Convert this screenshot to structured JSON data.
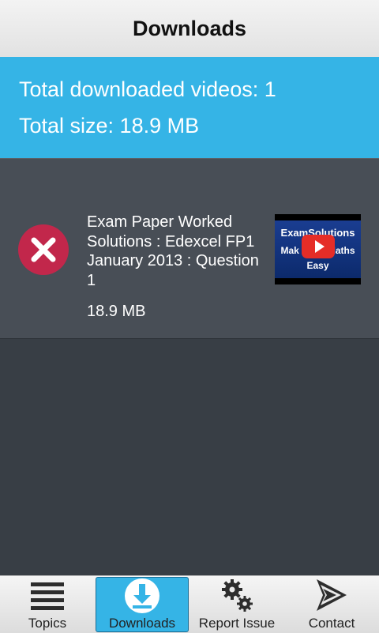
{
  "header": {
    "title": "Downloads"
  },
  "summary": {
    "total_videos": "Total downloaded videos: 1",
    "total_size": "Total size: 18.9 MB"
  },
  "downloads": [
    {
      "title": "Exam Paper Worked Solutions : Edexcel FP1 January 2013 : Question 1",
      "size": "18.9 MB",
      "thumbnail": {
        "brand": "ExamSolutions",
        "line2": "Maths",
        "line3": "Easy"
      }
    }
  ],
  "tabs": [
    {
      "label": "Topics",
      "icon": "menu-icon",
      "active": false
    },
    {
      "label": "Downloads",
      "icon": "download-icon",
      "active": true
    },
    {
      "label": "Report Issue",
      "icon": "gears-icon",
      "active": false
    },
    {
      "label": "Contact",
      "icon": "contact-icon",
      "active": false
    }
  ],
  "colors": {
    "accent": "#35b4e6",
    "delete": "#c2274b",
    "background": "#383e45",
    "item_background": "#484e56"
  }
}
